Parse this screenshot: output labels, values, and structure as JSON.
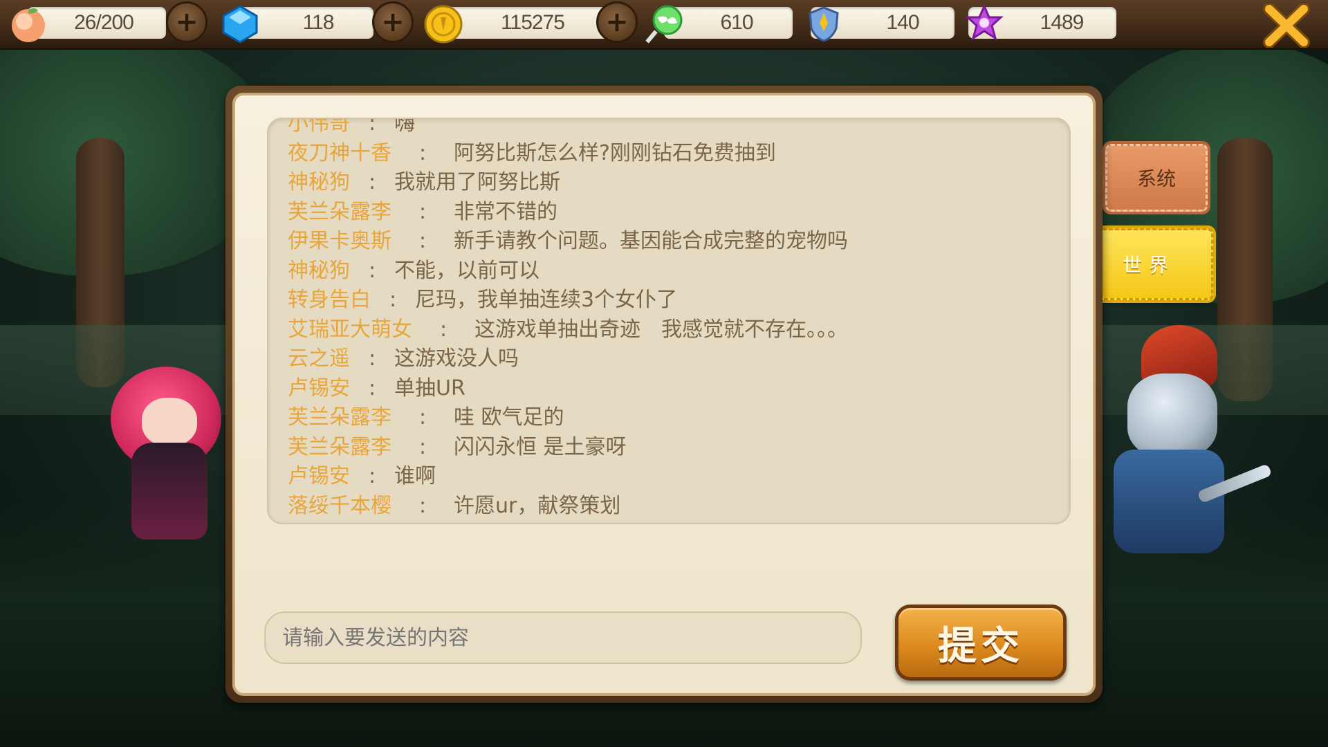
{
  "topbar": {
    "stamina": {
      "icon": "peach-icon",
      "value": "26/200"
    },
    "gems": {
      "icon": "blue-gem-icon",
      "value": "118"
    },
    "gold": {
      "icon": "gold-coin-icon",
      "value": "115275"
    },
    "candy": {
      "icon": "lollipop-icon",
      "value": "610"
    },
    "badge": {
      "icon": "shield-badge-icon",
      "value": "140"
    },
    "star": {
      "icon": "purple-star-icon",
      "value": "1489"
    }
  },
  "chat": {
    "messages": [
      {
        "name": "小伟哥",
        "text": "嗨",
        "wide": false
      },
      {
        "name": "夜刀神十香",
        "text": "阿努比斯怎么样?刚刚钻石免费抽到",
        "wide": true
      },
      {
        "name": "神秘狗",
        "text": "我就用了阿努比斯",
        "wide": false
      },
      {
        "name": "芙兰朵露李",
        "text": "非常不错的",
        "wide": true
      },
      {
        "name": "伊果卡奥斯",
        "text": "新手请教个问题。基因能合成完整的宠物吗",
        "wide": true
      },
      {
        "name": "神秘狗",
        "text": "不能，以前可以",
        "wide": false
      },
      {
        "name": "转身告白",
        "text": "尼玛，我单抽连续3个女仆了",
        "wide": false
      },
      {
        "name": "艾瑞亚大萌女",
        "text": "这游戏单抽出奇迹　我感觉就不存在。。。",
        "wide": true
      },
      {
        "name": "云之遥",
        "text": "这游戏没人吗",
        "wide": false
      },
      {
        "name": "卢锡安",
        "text": "单抽UR",
        "wide": false
      },
      {
        "name": "芙兰朵露李",
        "text": "哇  欧气足的",
        "wide": true
      },
      {
        "name": "芙兰朵露李",
        "text": "闪闪永恒  是土豪呀",
        "wide": true
      },
      {
        "name": "卢锡安",
        "text": "谁啊",
        "wide": false
      },
      {
        "name": "落绥千本樱",
        "text": "许愿ur，献祭策划",
        "wide": true
      }
    ],
    "colon": ":",
    "scroll_position": 0.62,
    "input_placeholder": "请输入要发送的内容",
    "submit_label": "提交"
  },
  "tabs": {
    "system": "系统",
    "world": "世界",
    "active": "world"
  },
  "colors": {
    "name_color": "#e8a53a",
    "text_color": "#7a6548",
    "active_tab": "#f5c818",
    "inactive_tab": "#cf7a48",
    "submit": "#dd8a1e"
  }
}
